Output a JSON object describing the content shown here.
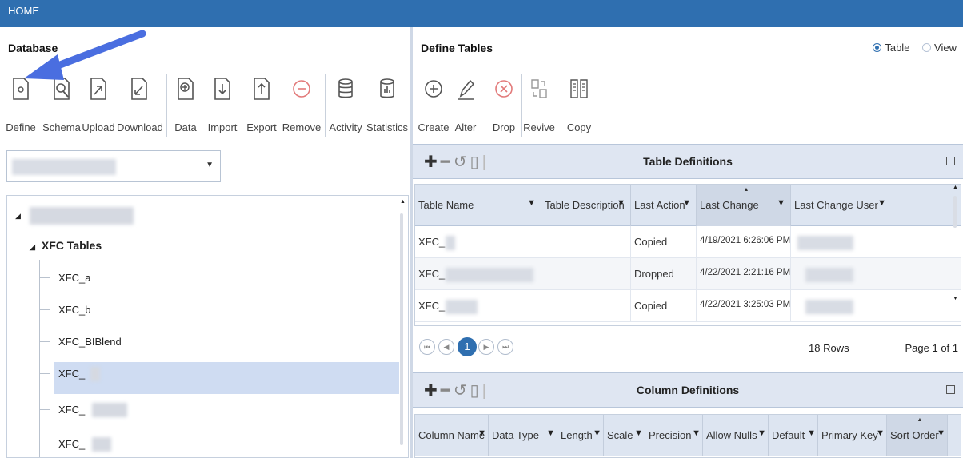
{
  "window": {
    "title": "HOME"
  },
  "database": {
    "title": "Database",
    "toolbar": [
      {
        "label": "Define",
        "icon": "define-icon"
      },
      {
        "label": "Schema",
        "icon": "schema-icon"
      },
      {
        "label": "Upload",
        "icon": "upload-icon"
      },
      {
        "label": "Download",
        "icon": "download-icon"
      },
      {
        "label": "Data",
        "icon": "data-icon"
      },
      {
        "label": "Import",
        "icon": "import-icon"
      },
      {
        "label": "Export",
        "icon": "export-icon"
      },
      {
        "label": "Remove",
        "icon": "remove-icon"
      },
      {
        "label": "Activity",
        "icon": "activity-icon"
      },
      {
        "label": "Statistics",
        "icon": "statistics-icon"
      }
    ],
    "tree": {
      "group": "XFC Tables",
      "items": [
        "XFC_a",
        "XFC_b",
        "XFC_BIBlend",
        "XFC_",
        "XFC_",
        "XFC_"
      ]
    }
  },
  "define_tables": {
    "title": "Define Tables",
    "mode_options": [
      "Table",
      "View"
    ],
    "mode_selected": "Table",
    "toolbar": [
      {
        "label": "Create",
        "icon": "create-icon"
      },
      {
        "label": "Alter",
        "icon": "alter-icon"
      },
      {
        "label": "Drop",
        "icon": "drop-icon"
      },
      {
        "label": "Revive",
        "icon": "revive-icon"
      },
      {
        "label": "Copy",
        "icon": "copy-icon"
      }
    ],
    "table_definitions": {
      "title": "Table Definitions",
      "columns": [
        "Table Name",
        "Table Description",
        "Last Action",
        "Last Change",
        "Last Change User"
      ],
      "rows": [
        {
          "name": "XFC_",
          "description": "",
          "action": "Copied",
          "change": "4/19/2021 6:26:06 PM"
        },
        {
          "name": "XFC_",
          "description": "",
          "action": "Dropped",
          "change": "4/22/2021 2:21:16 PM"
        },
        {
          "name": "XFC_",
          "description": "",
          "action": "Copied",
          "change": "4/22/2021 3:25:03 PM"
        }
      ],
      "pager": {
        "current_page": "1",
        "rows_text": "18 Rows",
        "page_text": "Page  1  of 1"
      }
    },
    "column_definitions": {
      "title": "Column Definitions",
      "columns": [
        "Column Name",
        "Data Type",
        "Length",
        "Scale",
        "Precision",
        "Allow Nulls",
        "Default",
        "Primary Key",
        "Sort Order"
      ]
    }
  },
  "colors": {
    "titlebar": "#2f6fb0",
    "annotation_arrow": "#4a6ee0",
    "selection": "#cfdcf2"
  }
}
